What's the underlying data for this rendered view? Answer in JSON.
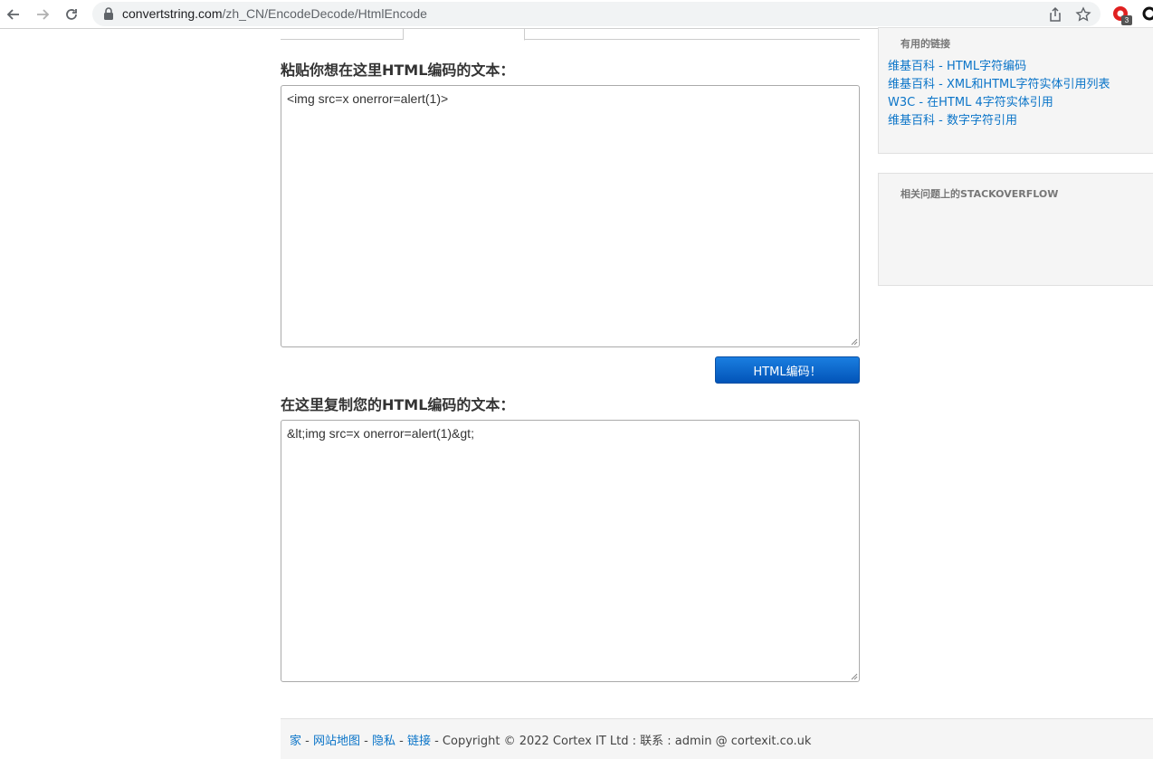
{
  "browser": {
    "url_domain": "convertstring.com",
    "url_path": "/zh_CN/EncodeDecode/HtmlEncode",
    "extension_badge": "3"
  },
  "input_section": {
    "heading": "粘贴你想在这里HTML编码的文本：",
    "value": "<img src=x onerror=alert(1)>"
  },
  "encode_button": {
    "label": "HTML编码！"
  },
  "output_section": {
    "heading": "在这里复制您的HTML编码的文本：",
    "value": "&lt;img src=x onerror=alert(1)&gt;"
  },
  "sidebar": {
    "useful_links": {
      "title": "有用的链接",
      "links": [
        "维基百科 - HTML字符编码",
        "维基百科 - XML和HTML字符实体引用列表",
        "W3C - 在HTML 4字符实体引用",
        "维基百科 - 数字字符引用"
      ]
    },
    "stackoverflow": {
      "title": "相关问题上的STACKOVERFLOW"
    }
  },
  "footer": {
    "home": "家",
    "sep": " - ",
    "sitemap": "网站地图",
    "privacy": "隐私",
    "links": "链接",
    "copyright": " - Copyright © 2022 Cortex IT Ltd : 联系 : admin @ cortexit.co.uk"
  }
}
